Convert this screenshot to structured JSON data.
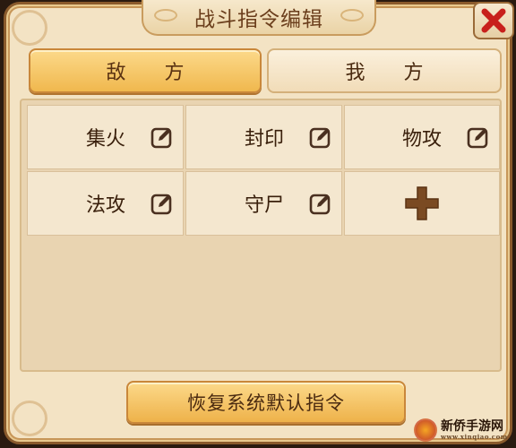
{
  "title": "战斗指令编辑",
  "close": {
    "icon": "close-icon"
  },
  "tabs": [
    {
      "label": "敌 方",
      "active": true
    },
    {
      "label": "我 方",
      "active": false
    }
  ],
  "commands": [
    {
      "label": "集火",
      "icon": "edit-icon"
    },
    {
      "label": "封印",
      "icon": "edit-icon"
    },
    {
      "label": "物攻",
      "icon": "edit-icon"
    },
    {
      "label": "法攻",
      "icon": "edit-icon"
    },
    {
      "label": "守尸",
      "icon": "edit-icon"
    }
  ],
  "add_slot": {
    "icon": "add-icon"
  },
  "restore_button": "恢复系统默认指令",
  "watermark": {
    "name": "新侨手游网",
    "url": "www.xinqiao.com"
  },
  "colors": {
    "panel_bg": "#f3e3c4",
    "accent_gold": "#f0b84e",
    "close_red": "#c8201c",
    "text_brown": "#3a200c"
  }
}
